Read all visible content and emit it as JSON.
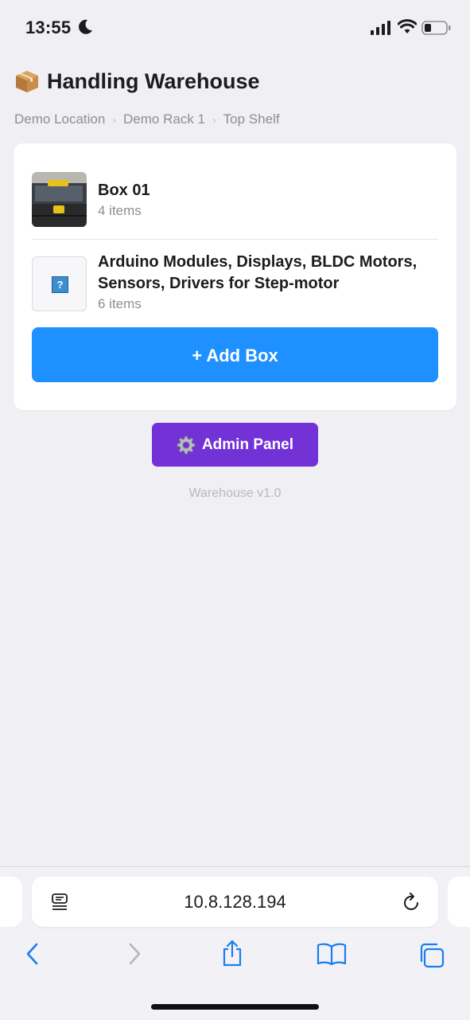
{
  "status_bar": {
    "time": "13:55"
  },
  "header": {
    "title": "Handling Warehouse",
    "icon": "package-icon"
  },
  "breadcrumb": [
    "Demo Location",
    "Demo Rack 1",
    "Top Shelf"
  ],
  "boxes": [
    {
      "name": "Box 01",
      "count": "4 items",
      "thumbnail": "toolbox-photo"
    },
    {
      "name": "Arduino Modules, Displays, BLDC Motors, Sensors, Drivers for Step-motor",
      "count": "6 items",
      "thumbnail": "question-mark-icon"
    }
  ],
  "actions": {
    "add_box": "+ Add Box",
    "admin_panel": "Admin Panel"
  },
  "footer": {
    "version": "Warehouse v1.0"
  },
  "browser": {
    "url": "10.8.128.194"
  },
  "colors": {
    "add_button": "#1e90ff",
    "admin_button": "#7232d6",
    "background": "#efeff4"
  }
}
